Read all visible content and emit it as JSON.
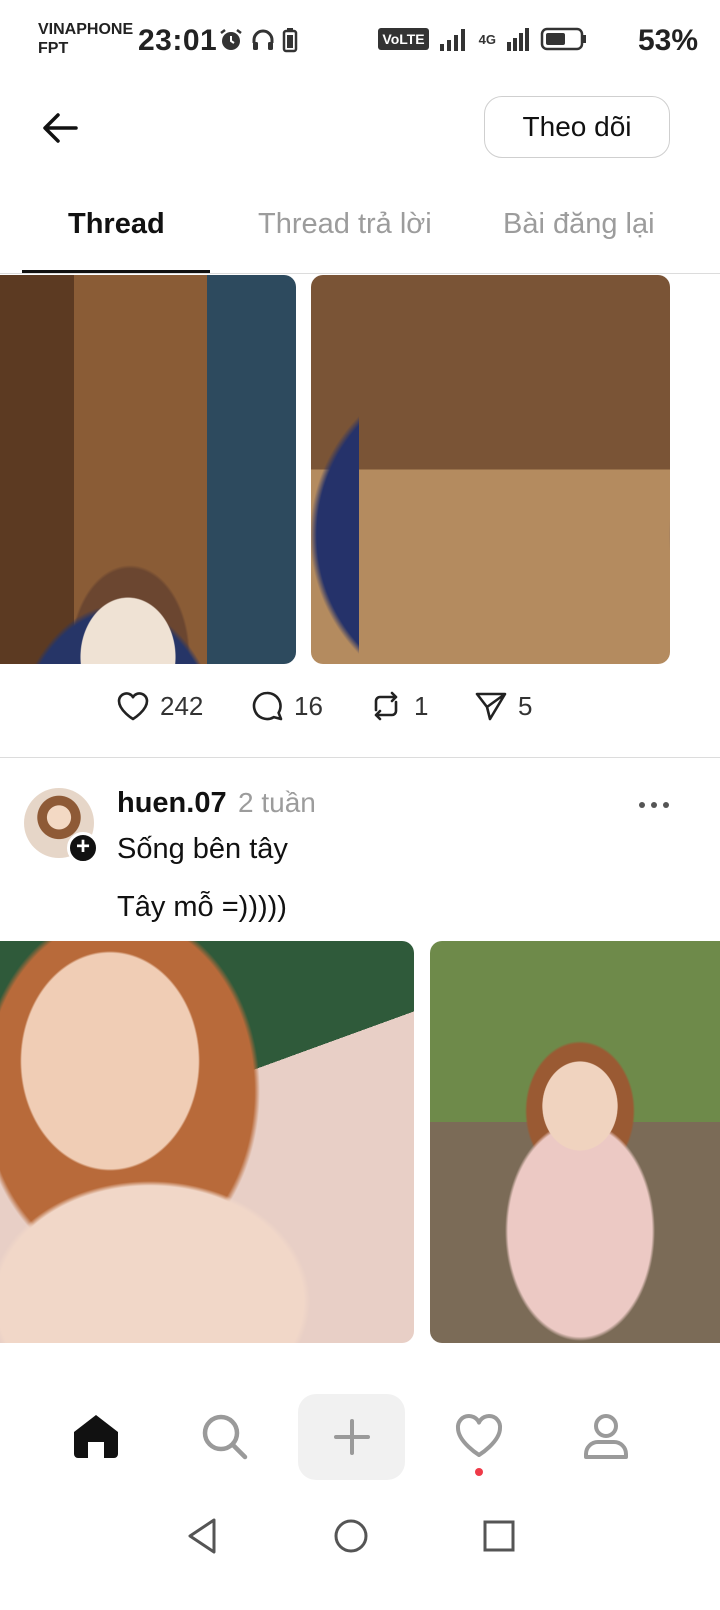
{
  "status_bar": {
    "carrier_line1": "VINAPHONE",
    "carrier_line2": "FPT",
    "time": "23:01",
    "volte": "VoLTE",
    "network": "4G",
    "battery": "53%"
  },
  "header": {
    "follow_label": "Theo dõi"
  },
  "tabs": [
    {
      "label": "Thread",
      "active": true
    },
    {
      "label": "Thread trả lời",
      "active": false
    },
    {
      "label": "Bài đăng lại",
      "active": false
    }
  ],
  "post1_stats": {
    "likes": "242",
    "comments": "16",
    "reposts": "1",
    "shares": "5"
  },
  "post2": {
    "username": "huen.07",
    "time": "2 tuần",
    "line1": "Sống bên tây",
    "line2": "Tây mỗ =)))))"
  },
  "icons": {
    "back": "arrow-left-icon",
    "like": "heart-icon",
    "comment": "comment-icon",
    "repost": "repost-icon",
    "share": "send-icon",
    "more": "more-horizontal-icon",
    "home": "home-icon",
    "search": "search-icon",
    "create": "plus-icon",
    "activity": "heart-icon",
    "profile": "user-icon"
  },
  "colors": {
    "notification_dot": "#ef3a48",
    "inactive_tab": "#9c9c9c"
  }
}
